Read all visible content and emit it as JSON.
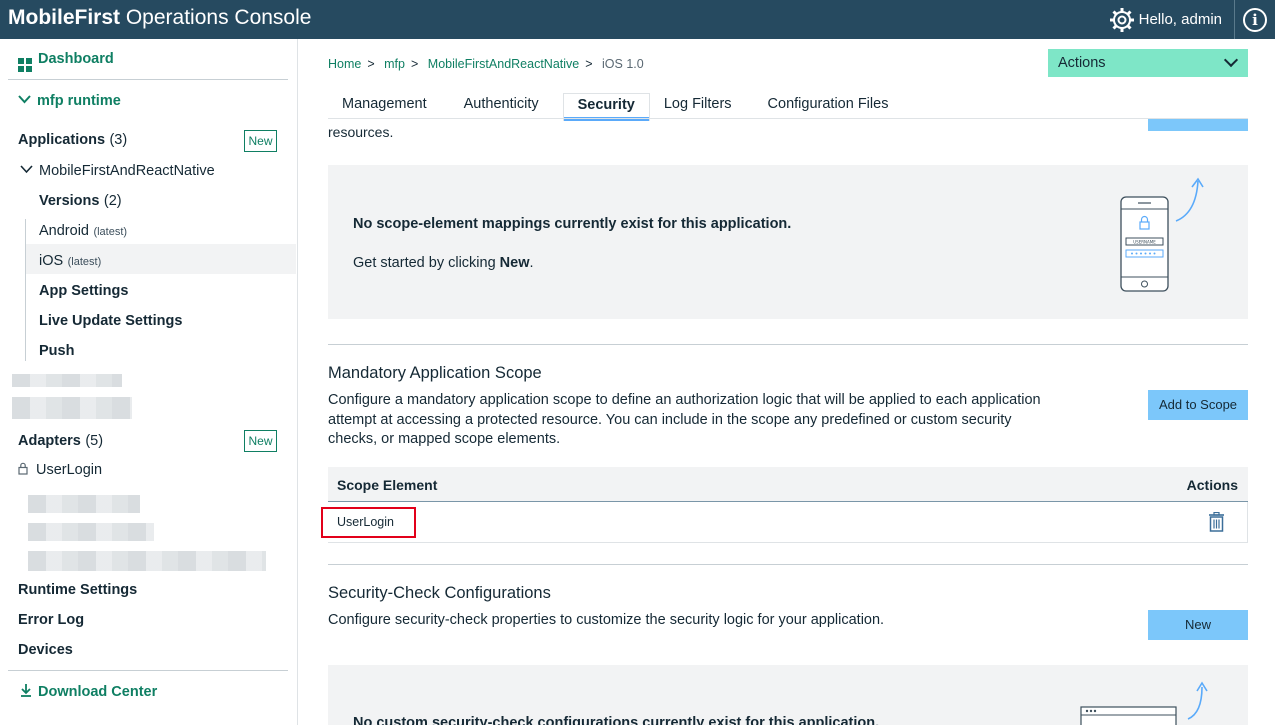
{
  "header": {
    "brand_bold": "MobileFirst",
    "brand_rest": " Operations Console",
    "greeting": "Hello, admin",
    "info_glyph": "i"
  },
  "sidebar": {
    "dashboard": "Dashboard",
    "runtime": "mfp runtime",
    "applications_label": "Applications",
    "applications_count": "(3)",
    "new_label": "New",
    "app_name": "MobileFirstAndReactNative",
    "versions_label": "Versions",
    "versions_count": "(2)",
    "android_label": "Android",
    "android_tag": "(latest)",
    "ios_label": "iOS",
    "ios_tag": "(latest)",
    "app_settings": "App Settings",
    "live_update": "Live Update Settings",
    "push": "Push",
    "adapters_label": "Adapters",
    "adapters_count": "(5)",
    "adapter_item": "UserLogin",
    "runtime_settings": "Runtime Settings",
    "error_log": "Error Log",
    "devices": "Devices",
    "download_center": "Download Center"
  },
  "breadcrumb": [
    "Home",
    "mfp",
    "MobileFirstAndReactNative",
    "iOS 1.0"
  ],
  "actions_label": "Actions",
  "tabs": [
    "Management",
    "Authenticity",
    "Security",
    "Log Filters",
    "Configuration Files"
  ],
  "cut_text": "resources.",
  "scope_mapping": {
    "message": "No scope-element mappings currently exist for this application.",
    "hint_prefix": "Get started by clicking ",
    "hint_bold": "New",
    "hint_suffix": ".",
    "phone_user": "USERNAME"
  },
  "mandatory": {
    "title": "Mandatory Application Scope",
    "description": "Configure a mandatory application scope to define an authorization logic that will be applied to each application attempt at accessing a protected resource. You can include in the scope any predefined or custom security checks, or mapped scope elements.",
    "button": "Add to Scope",
    "col_element": "Scope Element",
    "col_actions": "Actions",
    "rows": [
      "UserLogin"
    ]
  },
  "security_check": {
    "title": "Security-Check Configurations",
    "description": "Configure security-check properties to customize the security logic for your application.",
    "button": "New",
    "cut_message": "No custom security-check configurations currently exist for this application."
  },
  "colors": {
    "topbar": "#264a60",
    "accent_green": "#0f7f63",
    "actions_bg": "#7ee6c7",
    "button_blue": "#7cc7fa",
    "tab_underline": "#5aaafa",
    "highlight_red": "#e2001a"
  }
}
